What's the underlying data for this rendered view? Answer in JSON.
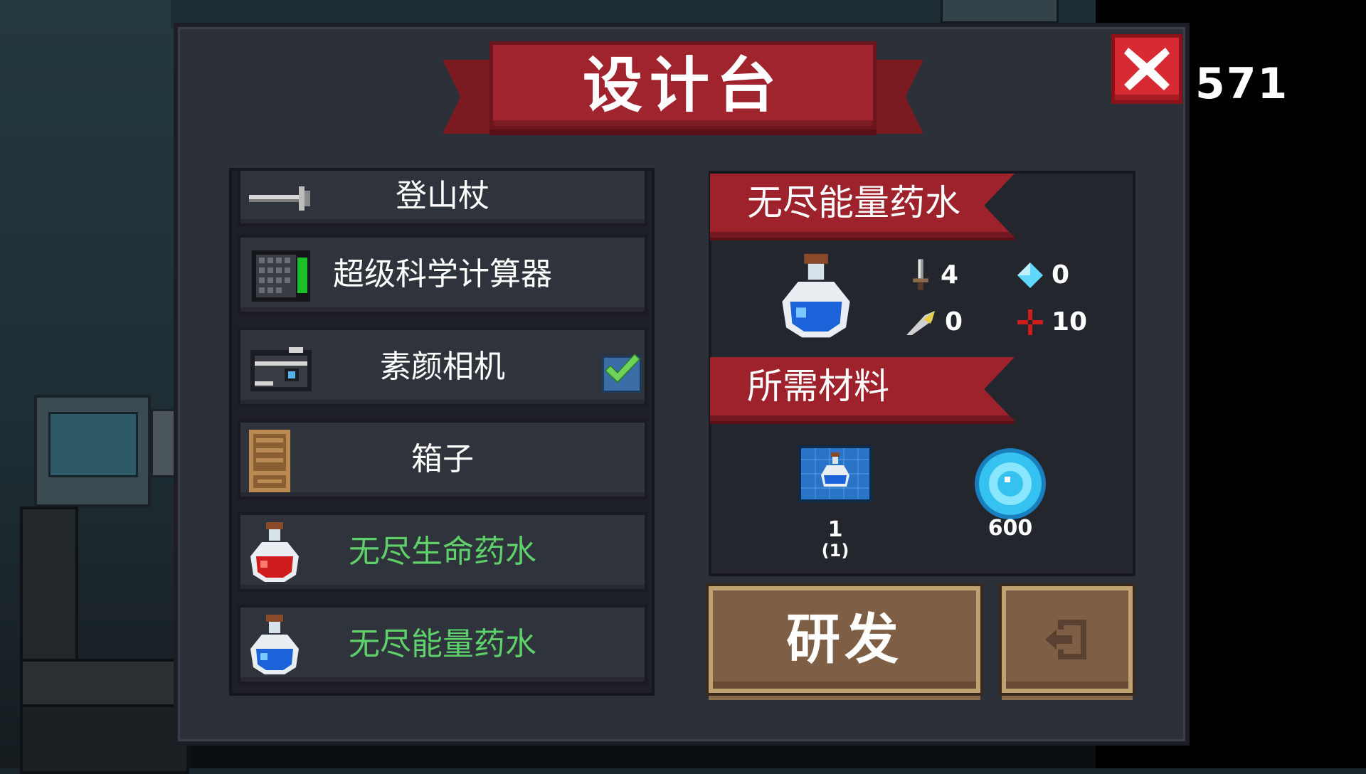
{
  "hud": {
    "number": "571"
  },
  "title": "设计台",
  "list": {
    "items": [
      {
        "label": "登山杖",
        "icon": "climbing-stick-icon",
        "color": "white",
        "checked": false
      },
      {
        "label": "超级科学计算器",
        "icon": "calculator-icon",
        "color": "white",
        "checked": false
      },
      {
        "label": "素颜相机",
        "icon": "camera-icon",
        "color": "white",
        "checked": true
      },
      {
        "label": "箱子",
        "icon": "box-icon",
        "color": "white",
        "checked": false
      },
      {
        "label": "无尽生命药水",
        "icon": "red-potion-icon",
        "color": "#5fd16a",
        "checked": false
      },
      {
        "label": "无尽能量药水",
        "icon": "blue-potion-icon",
        "color": "#5fd16a",
        "checked": false
      }
    ]
  },
  "detail": {
    "title": "无尽能量药水",
    "icon": "blue-potion-icon",
    "stats": {
      "attack": "4",
      "energy": "0",
      "crit": "0",
      "accuracy": "10"
    },
    "materials_title": "所需材料",
    "materials": [
      {
        "icon": "potion-blueprint-icon",
        "count": "1",
        "owned": "(1)"
      },
      {
        "icon": "gem-coin-icon",
        "count": "600"
      }
    ]
  },
  "buttons": {
    "research": "研发",
    "exit_icon": "exit-icon",
    "close_icon": "close-icon"
  }
}
